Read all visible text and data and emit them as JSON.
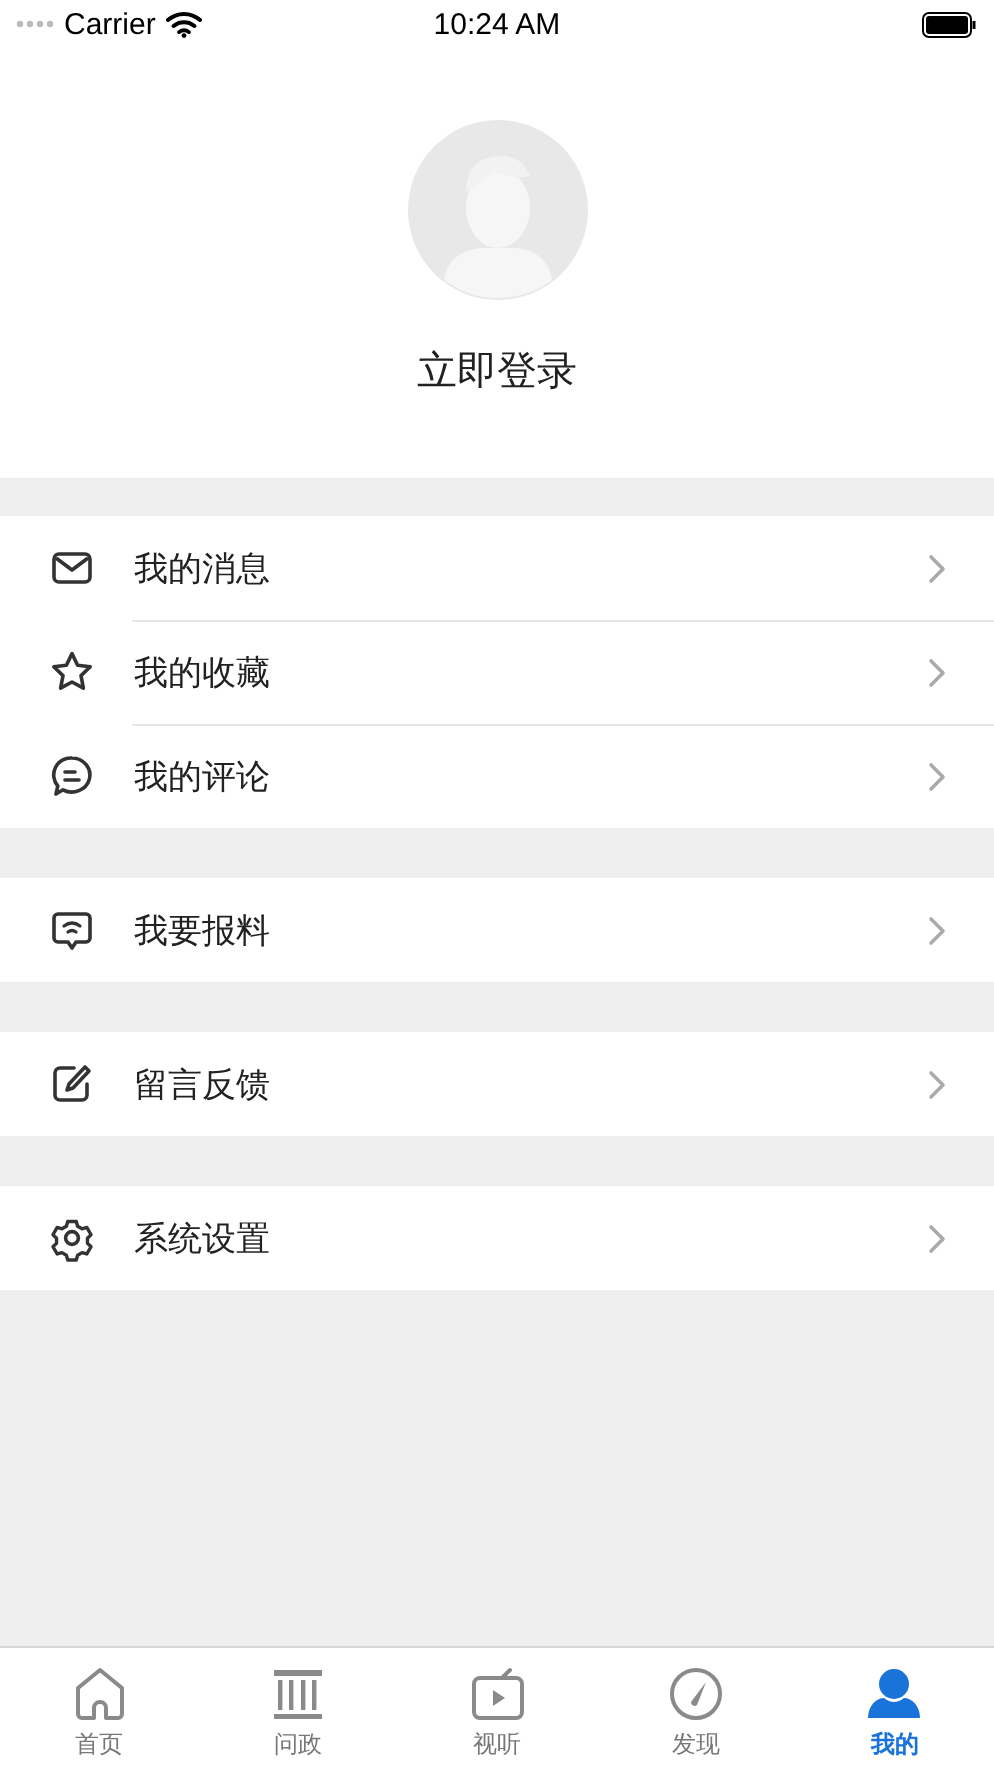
{
  "status_bar": {
    "carrier": "Carrier",
    "time": "10:24 AM"
  },
  "profile": {
    "login_label": "立即登录"
  },
  "menu_groups": [
    {
      "items": [
        {
          "label": "我的消息",
          "kind": "mail"
        },
        {
          "label": "我的收藏",
          "kind": "star"
        },
        {
          "label": "我的评论",
          "kind": "comment"
        }
      ]
    },
    {
      "items": [
        {
          "label": "我要报料",
          "kind": "report"
        }
      ]
    },
    {
      "items": [
        {
          "label": "留言反馈",
          "kind": "edit"
        }
      ]
    },
    {
      "items": [
        {
          "label": "系统设置",
          "kind": "settings"
        }
      ]
    }
  ],
  "tab_bar": [
    {
      "label": "首页",
      "kind": "home",
      "selected": false
    },
    {
      "label": "问政",
      "kind": "hall",
      "selected": false
    },
    {
      "label": "视听",
      "kind": "tv",
      "selected": false
    },
    {
      "label": "发现",
      "kind": "gauge",
      "selected": false
    },
    {
      "label": "我的",
      "kind": "person",
      "selected": true
    }
  ]
}
